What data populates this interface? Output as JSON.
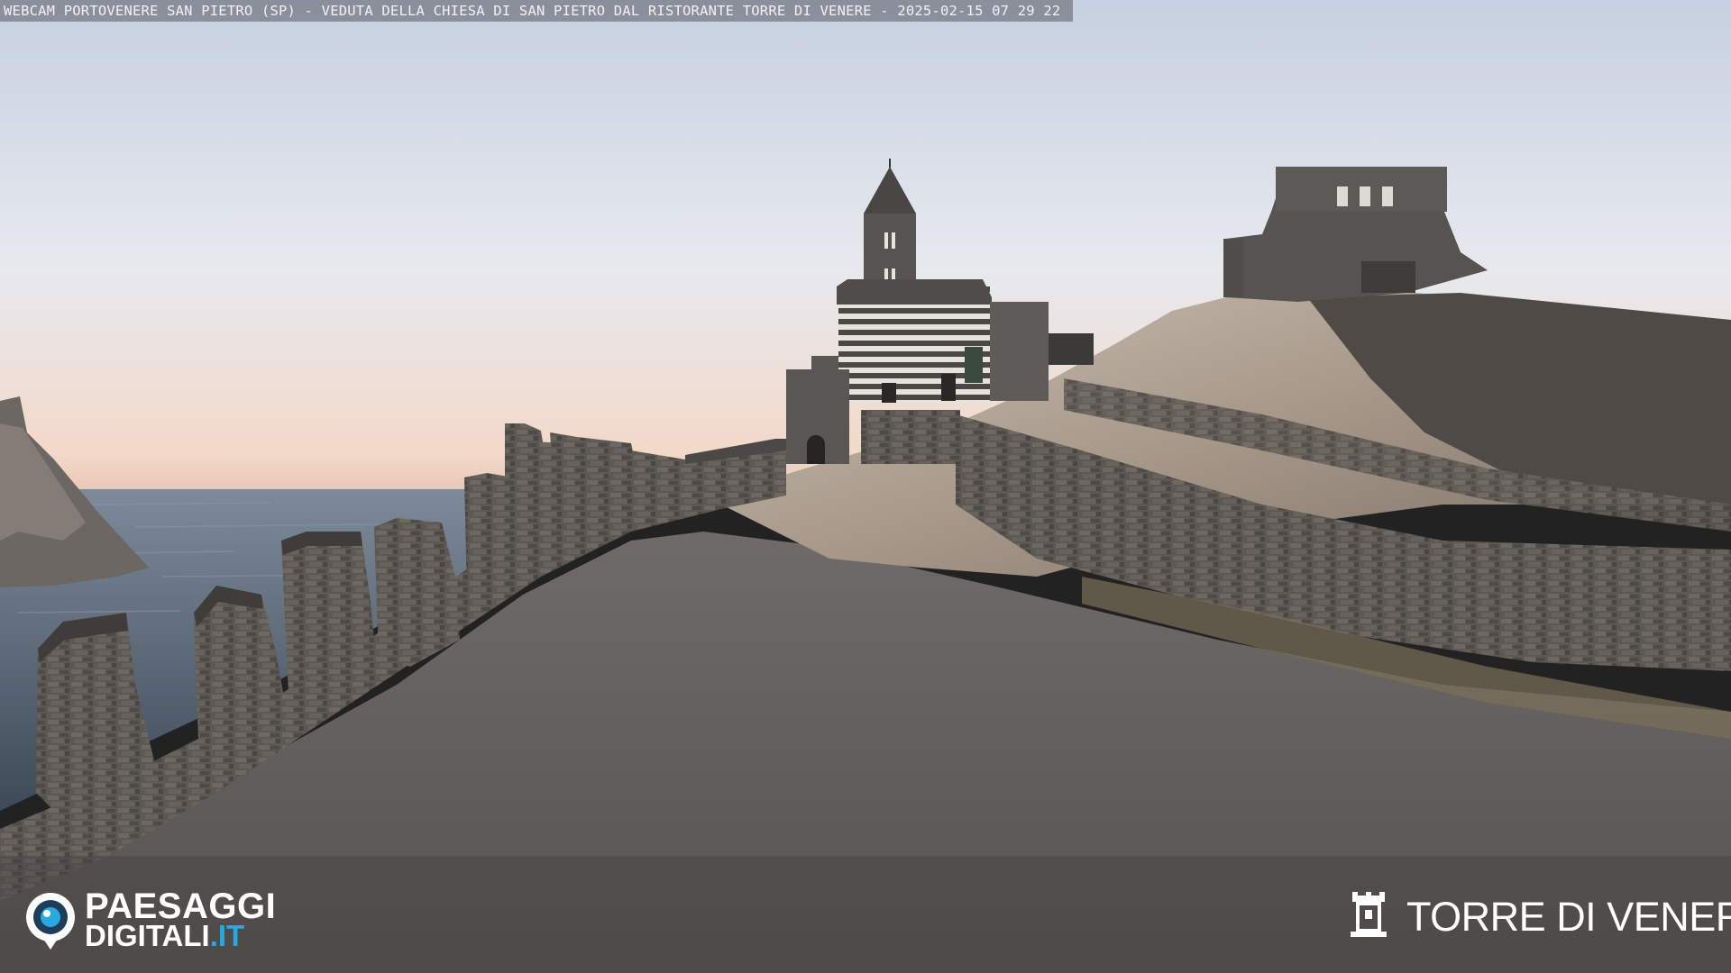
{
  "overlay": {
    "caption": "WEBCAM PORTOVENERE SAN PIETRO (SP) - VEDUTA DELLA CHIESA DI SAN PIETRO DAL RISTORANTE TORRE DI VENERE - 2025-02-15 07 29 22"
  },
  "logos": {
    "left": {
      "line1": "PAESAGGI",
      "line2_main": "DIGITALI",
      "line2_tld": ".IT",
      "icon": "eye-pin-icon"
    },
    "right": {
      "title": "TORRE DI VENERE",
      "icon": "tower-icon"
    }
  },
  "colors": {
    "sky_top": "#c9d3e2",
    "sky_horizon": "#f0d8c8",
    "sea": "#56667a",
    "path": "#6b6866",
    "stone": "#5e5a55",
    "logo_accent": "#29a9e0"
  }
}
